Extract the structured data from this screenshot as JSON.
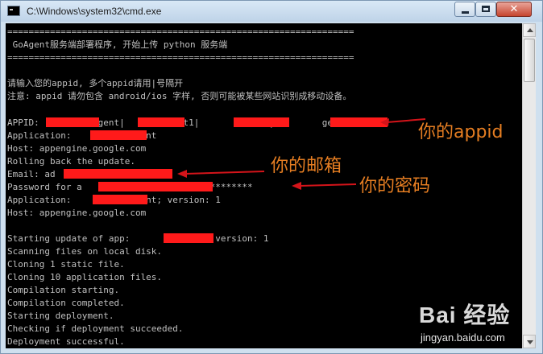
{
  "window": {
    "title": "C:\\Windows\\system32\\cmd.exe",
    "icons": [
      "cmd-icon",
      "minimize-icon",
      "maximize-icon",
      "close-icon"
    ],
    "close_glyph": "✕"
  },
  "console": {
    "lines": [
      "=================================================================",
      " GoAgent服务端部署程序, 开始上传 python 服务端",
      "=================================================================",
      "",
      "请输入您的appid, 多个appid请用|号隔开",
      "注意: appid 请勿包含 android/ios 字样, 否则可能被某些网站识别成移动设备。",
      "",
      "APPID:          agent|       agent1|        gent2|         gent3",
      "Application:           agent",
      "Host: appengine.google.com",
      "Rolling back the update.",
      "Email: ad",
      "Password for a                     : *********",
      "Application:            gent; version: 1",
      "Host: appengine.google.com",
      "",
      "Starting update of app:         agent, version: 1",
      "Scanning files on local disk.",
      "Cloning 1 static file.",
      "Cloning 10 application files.",
      "Compilation starting.",
      "Compilation completed.",
      "Starting deployment.",
      "Checking if deployment succeeded.",
      "Deployment successful."
    ]
  },
  "annotations": {
    "appid": "你的appid",
    "email": "你的邮箱",
    "password": "你的密码"
  },
  "watermark": {
    "logo_text": "Bai 经验",
    "url": "jingyan.baidu.com"
  },
  "colors": {
    "console_bg": "#000000",
    "console_text": "#c0c0c0",
    "redaction": "#ff1a1a",
    "annotation": "#e67e22",
    "arrow": "#d4141a"
  }
}
